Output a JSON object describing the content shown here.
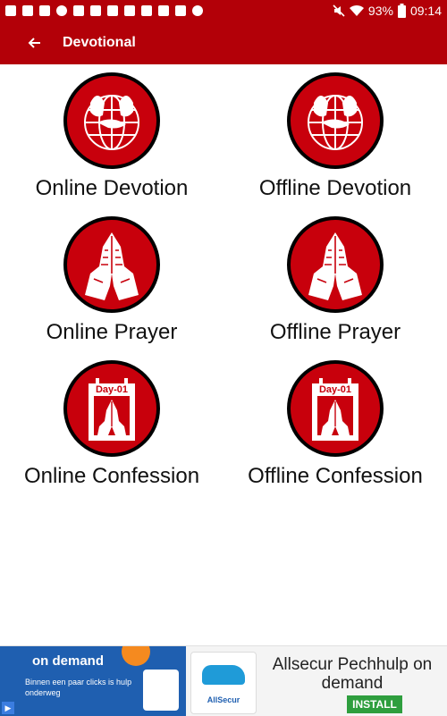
{
  "status_bar": {
    "battery": "93%",
    "time": "09:14"
  },
  "app_bar": {
    "title": "Devotional"
  },
  "tiles": [
    {
      "label": "Online Devotion",
      "icon": "globe-hands-icon"
    },
    {
      "label": "Offline Devotion",
      "icon": "globe-hands-icon"
    },
    {
      "label": "Online Prayer",
      "icon": "praying-hands-icon"
    },
    {
      "label": "Offline Prayer",
      "icon": "praying-hands-icon"
    },
    {
      "label": "Online Confession",
      "icon": "calendar-prayer-icon",
      "badge": "Day-01"
    },
    {
      "label": "Offline Confession",
      "icon": "calendar-prayer-icon",
      "badge": "Day-01"
    }
  ],
  "ad": {
    "left_heading": "on demand",
    "left_sub": "Binnen een paar clicks is hulp onderweg",
    "logo_text": "AllSecur",
    "title": "Allsecur Pechhulp on demand",
    "install_label": "INSTALL"
  },
  "colors": {
    "brand": "#b30008",
    "icon_red": "#c8000c",
    "install_green": "#2e9e3e"
  }
}
